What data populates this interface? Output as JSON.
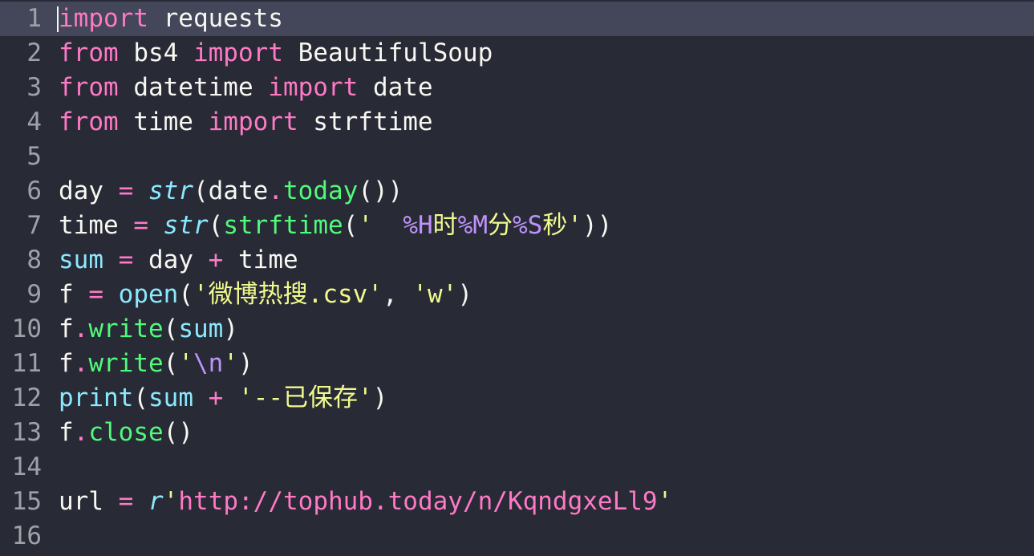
{
  "editor": {
    "language": "python",
    "theme": "dark",
    "current_line": 1,
    "colors": {
      "background": "#282a36",
      "current_line": "#44475a",
      "line_number": "#a0a0a8",
      "plain": "#f8f8f2",
      "keyword": "#ff79c6",
      "function": "#50fa7b",
      "builtin": "#8be9fd",
      "string": "#f1fa8c",
      "format": "#bd93f9"
    },
    "lines": [
      {
        "n": "1",
        "tokens": [
          [
            "kw",
            "import"
          ],
          [
            "pl",
            " requests"
          ]
        ]
      },
      {
        "n": "2",
        "tokens": [
          [
            "kw",
            "from"
          ],
          [
            "pl",
            " bs4 "
          ],
          [
            "kw",
            "import"
          ],
          [
            "pl",
            " BeautifulSoup"
          ]
        ]
      },
      {
        "n": "3",
        "tokens": [
          [
            "kw",
            "from"
          ],
          [
            "pl",
            " datetime "
          ],
          [
            "kw",
            "import"
          ],
          [
            "pl",
            " date"
          ]
        ]
      },
      {
        "n": "4",
        "tokens": [
          [
            "kw",
            "from"
          ],
          [
            "pl",
            " time "
          ],
          [
            "kw",
            "import"
          ],
          [
            "pl",
            " strftime"
          ]
        ]
      },
      {
        "n": "5",
        "tokens": []
      },
      {
        "n": "6",
        "tokens": [
          [
            "pl",
            "day "
          ],
          [
            "op",
            "="
          ],
          [
            "pl",
            " "
          ],
          [
            "bi-i",
            "str"
          ],
          [
            "pl",
            "(date"
          ],
          [
            "op",
            "."
          ],
          [
            "fn",
            "today"
          ],
          [
            "pl",
            "())"
          ]
        ]
      },
      {
        "n": "7",
        "tokens": [
          [
            "pl",
            "time "
          ],
          [
            "op",
            "="
          ],
          [
            "pl",
            " "
          ],
          [
            "bi-i",
            "str"
          ],
          [
            "pl",
            "("
          ],
          [
            "fn",
            "strftime"
          ],
          [
            "pl",
            "("
          ],
          [
            "str",
            "'  "
          ],
          [
            "fmt",
            "%H"
          ],
          [
            "str",
            "时"
          ],
          [
            "fmt",
            "%M"
          ],
          [
            "str",
            "分"
          ],
          [
            "fmt",
            "%S"
          ],
          [
            "str",
            "秒'"
          ],
          [
            "pl",
            "))"
          ]
        ]
      },
      {
        "n": "8",
        "tokens": [
          [
            "bi",
            "sum"
          ],
          [
            "pl",
            " "
          ],
          [
            "op",
            "="
          ],
          [
            "pl",
            " day "
          ],
          [
            "op",
            "+"
          ],
          [
            "pl",
            " time"
          ]
        ]
      },
      {
        "n": "9",
        "tokens": [
          [
            "pl",
            "f "
          ],
          [
            "op",
            "="
          ],
          [
            "pl",
            " "
          ],
          [
            "bi",
            "open"
          ],
          [
            "pl",
            "("
          ],
          [
            "str",
            "'微博热搜.csv'"
          ],
          [
            "pl",
            ", "
          ],
          [
            "str",
            "'w'"
          ],
          [
            "pl",
            ")"
          ]
        ]
      },
      {
        "n": "10",
        "tokens": [
          [
            "pl",
            "f"
          ],
          [
            "op",
            "."
          ],
          [
            "fn",
            "write"
          ],
          [
            "pl",
            "("
          ],
          [
            "bi",
            "sum"
          ],
          [
            "pl",
            ")"
          ]
        ]
      },
      {
        "n": "11",
        "tokens": [
          [
            "pl",
            "f"
          ],
          [
            "op",
            "."
          ],
          [
            "fn",
            "write"
          ],
          [
            "pl",
            "("
          ],
          [
            "str",
            "'"
          ],
          [
            "fmt",
            "\\n"
          ],
          [
            "str",
            "'"
          ],
          [
            "pl",
            ")"
          ]
        ]
      },
      {
        "n": "12",
        "tokens": [
          [
            "bi",
            "print"
          ],
          [
            "pl",
            "("
          ],
          [
            "bi",
            "sum"
          ],
          [
            "pl",
            " "
          ],
          [
            "op",
            "+"
          ],
          [
            "pl",
            " "
          ],
          [
            "str",
            "'--已保存'"
          ],
          [
            "pl",
            ")"
          ]
        ]
      },
      {
        "n": "13",
        "tokens": [
          [
            "pl",
            "f"
          ],
          [
            "op",
            "."
          ],
          [
            "fn",
            "close"
          ],
          [
            "pl",
            "()"
          ]
        ]
      },
      {
        "n": "14",
        "tokens": []
      },
      {
        "n": "15",
        "tokens": [
          [
            "pl",
            "url "
          ],
          [
            "op",
            "="
          ],
          [
            "pl",
            " "
          ],
          [
            "bi-i",
            "r"
          ],
          [
            "str",
            "'"
          ],
          [
            "url",
            "http://tophub.today/n/KqndgxeLl9"
          ],
          [
            "str",
            "'"
          ]
        ]
      },
      {
        "n": "16",
        "tokens": []
      }
    ]
  }
}
